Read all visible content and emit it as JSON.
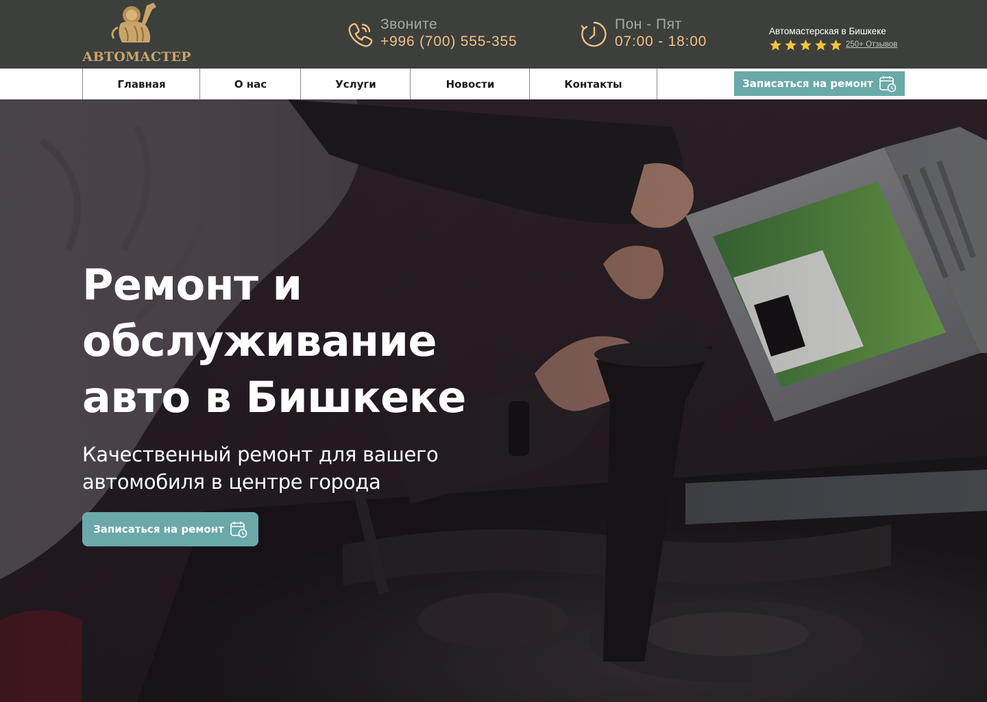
{
  "header": {
    "logo_text": "АВТОМАСТЕР",
    "phone": {
      "label": "Звоните",
      "value": "+996 (700) 555-355"
    },
    "hours": {
      "label": "Пон - Пят",
      "value": "07:00 - 18:00"
    },
    "rating": {
      "title": "Автомастерская в Бишкеке",
      "stars": 5,
      "reviews_link": "250+ Отзывов"
    }
  },
  "nav": {
    "items": [
      {
        "label": "Главная"
      },
      {
        "label": "О нас"
      },
      {
        "label": "Услуги"
      },
      {
        "label": "Новости"
      },
      {
        "label": "Контакты"
      }
    ],
    "cta_label": "Записаться на ремонт"
  },
  "hero": {
    "title": "Ремонт и обслуживание авто в Бишкеке",
    "subtitle": "Качественный ремонт для вашего автомобиля в центре города",
    "cta_label": "Записаться на ремонт"
  },
  "colors": {
    "header_bg": "#3c3f3c",
    "accent_orange": "#f2bf86",
    "logo_gold": "#c9a46a",
    "button_teal": "#6aa9a8",
    "star_yellow": "#f6c33a"
  },
  "icons": {
    "phone": "phone-icon",
    "clock": "clock-icon",
    "calendar": "calendar-clock-icon",
    "logo": "lion-wrench-icon",
    "star": "star-icon"
  }
}
